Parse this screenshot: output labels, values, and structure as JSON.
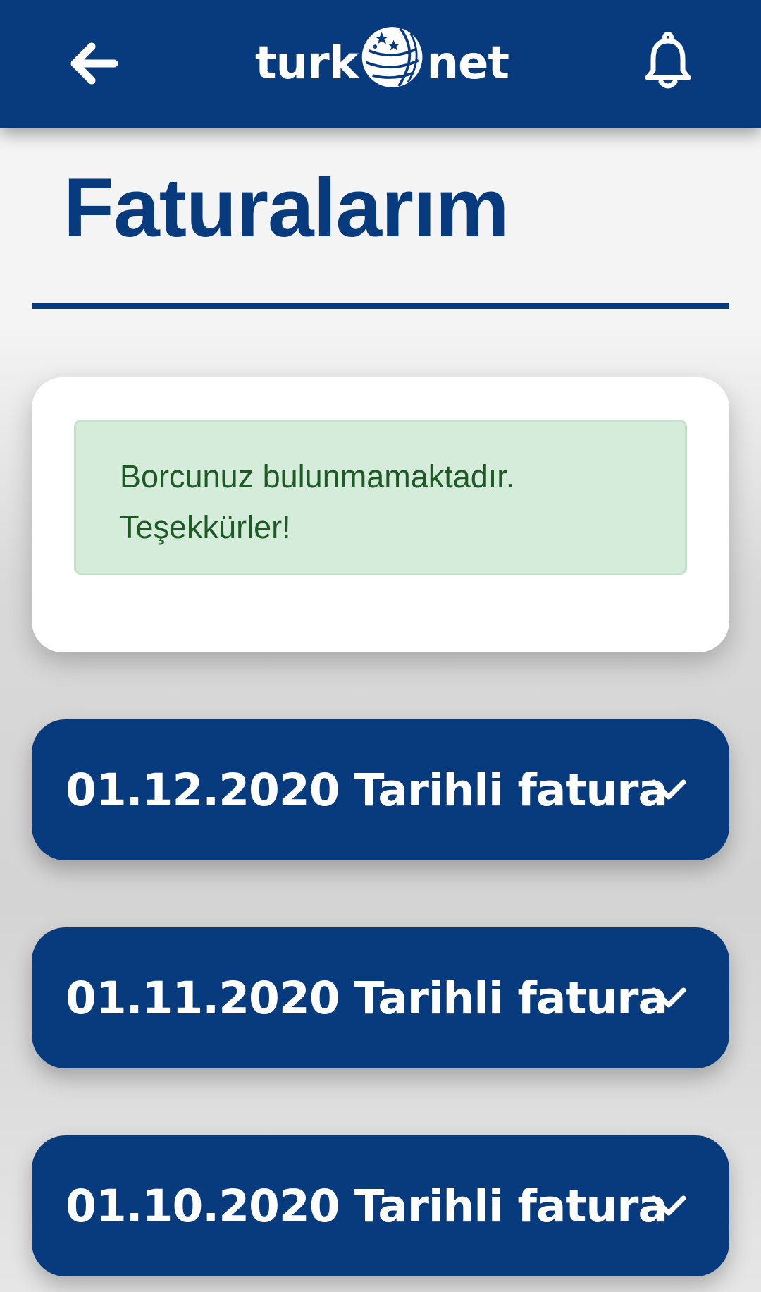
{
  "header": {
    "logo_left": "turk",
    "logo_right": "net",
    "back_icon": "arrow-left-icon",
    "notification_icon": "bell-icon"
  },
  "page": {
    "title": "Faturalarım"
  },
  "status": {
    "line1": "Borcunuz bulunmamaktadır.",
    "line2": "Teşekkürler!"
  },
  "invoices": [
    {
      "label": "01.12.2020 Tarihli fatura"
    },
    {
      "label": "01.11.2020 Tarihli fatura"
    },
    {
      "label": "01.10.2020 Tarihli fatura"
    }
  ],
  "colors": {
    "brand": "#073b7e",
    "success_bg": "#d4ecd9",
    "success_text": "#1d5a26"
  }
}
